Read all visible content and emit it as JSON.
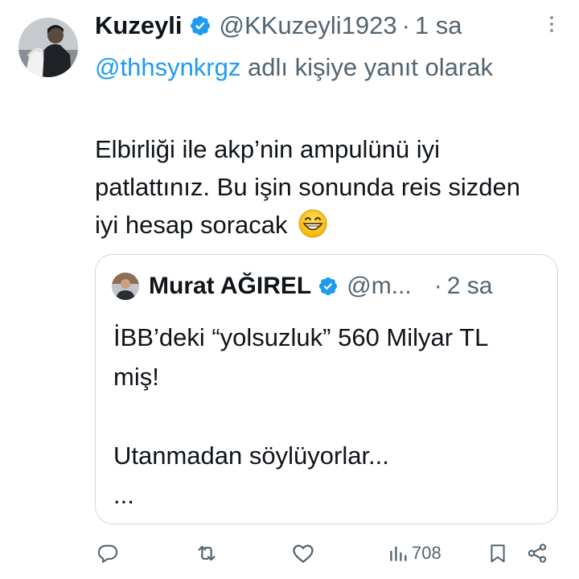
{
  "tweet": {
    "author": {
      "display_name": "Kuzeyli",
      "handle": "@KKuzeyli1923",
      "time_sep": "·",
      "time": "1 sa"
    },
    "reply": {
      "mention": "@thhsynkrgz",
      "suffix": " adlı kişiye yanıt olarak"
    },
    "text": "Elbirliği ile akp’nin ampulünü iyi patlattınız. Bu işin sonunda reis sizden iyi hesap soracak",
    "emoji": "grinning-face-with-smiling-eyes"
  },
  "quote": {
    "author": {
      "display_name": "Murat AĞIREL",
      "handle": "@m...",
      "time_sep": "·",
      "time": "2 sa"
    },
    "lines": [
      "İBB’deki “yolsuzluk” 560 Milyar TL miş!",
      "Utanmadan söylüyorlar...",
      "..."
    ]
  },
  "actions": {
    "reply_icon": "reply-icon",
    "retweet_icon": "retweet-icon",
    "like_icon": "like-icon",
    "views_icon": "views-icon",
    "views_count": "708",
    "bookmark_icon": "bookmark-icon",
    "share_icon": "share-icon"
  },
  "colors": {
    "accent": "#1d9bf0",
    "secondary_text": "#536471",
    "border": "#cfd9de"
  }
}
